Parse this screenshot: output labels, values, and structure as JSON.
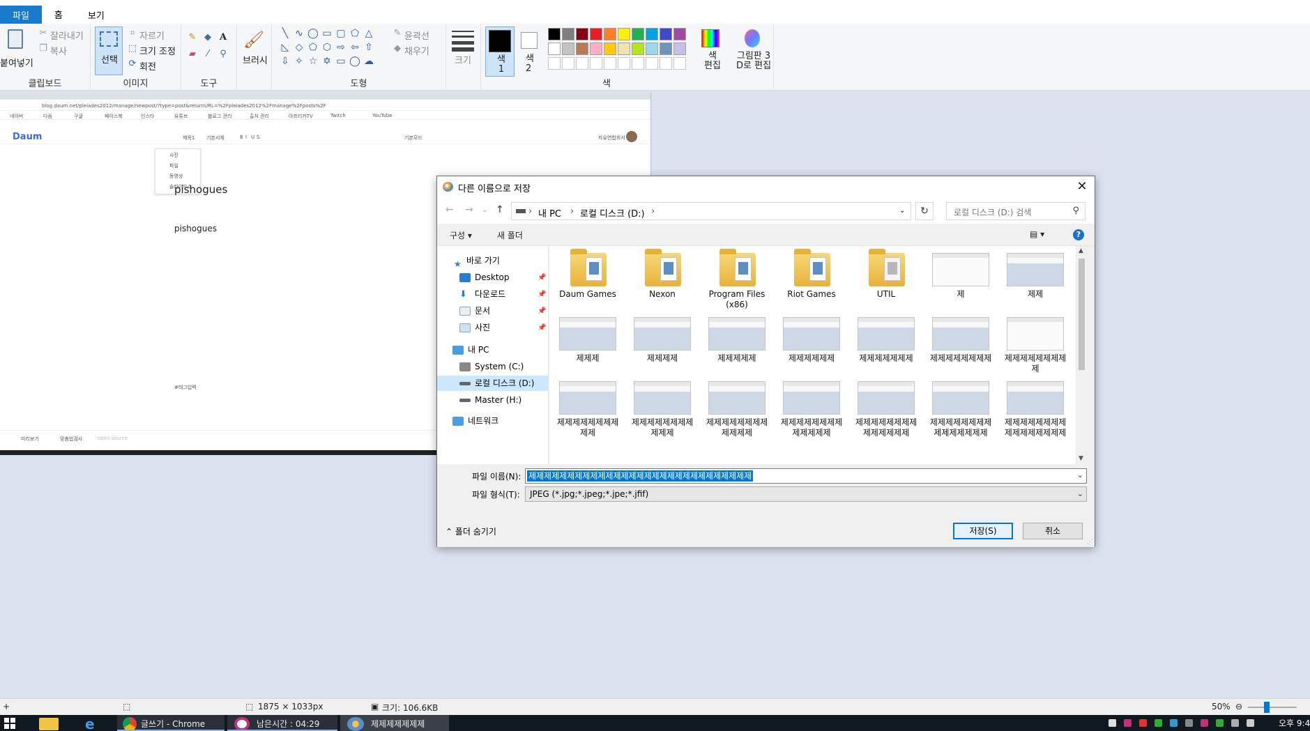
{
  "menu": {
    "file": "파일",
    "home": "홈",
    "view": "보기"
  },
  "ribbon": {
    "clipboard": {
      "paste": "붙여넣기",
      "cut": "잘라내기",
      "copy": "복사",
      "label": "클립보드"
    },
    "image": {
      "select": "선택",
      "crop": "자르기",
      "resize": "크기 조정",
      "rotate": "회전",
      "label": "이미지"
    },
    "tools": {
      "label": "도구"
    },
    "brushes": {
      "label": "브러시"
    },
    "shapes": {
      "outline": "윤곽선",
      "fill": "채우기",
      "label": "도형"
    },
    "size": {
      "label": "크기"
    },
    "colors": {
      "color1": "색\n1",
      "color2": "색\n2",
      "edit": "색\n편집",
      "label": "색",
      "palette_row1": [
        "#000000",
        "#7f7f7f",
        "#880015",
        "#ed1c24",
        "#ff7f27",
        "#fff200",
        "#22b14c",
        "#00a2e8",
        "#3f48cc",
        "#a349a4"
      ],
      "palette_row2": [
        "#ffffff",
        "#c3c3c3",
        "#b97a57",
        "#ffaec9",
        "#ffc90e",
        "#efe4b0",
        "#b5e61d",
        "#99d9ea",
        "#7092be",
        "#c8bfe7"
      ]
    },
    "paint3d": "그림판 3\nD로 편집"
  },
  "canvas": {
    "address": "blog.daum.net/pleiades2012/manage/newpost/?type=post&returnURL=%2Fpleiades2012%2Fmanage%2Fposts%2F",
    "bookmarks": [
      "네이버",
      "다음",
      "구글",
      "페이스북",
      "인스타",
      "유튜브",
      "블로그 관리",
      "출처 관리",
      "아프리카TV",
      "Twitch",
      "YouTube"
    ],
    "logo": "Daum",
    "toolbar_items": [
      "제목1",
      "기본서체",
      "B",
      "I",
      "U",
      "S",
      "기본모드"
    ],
    "dropdown": [
      "사진",
      "파일",
      "동영상",
      "슬라이드쇼"
    ],
    "title_text": "pishogues",
    "body_text": "pishogues",
    "tag_placeholder": "#태그입력",
    "footer_items": [
      "미리보기",
      "맞춤법검사",
      "open source"
    ],
    "user_name": "자유연합회서"
  },
  "dialog": {
    "title": "다른 이름으로 저장",
    "breadcrumb": [
      "내 PC",
      "로컬 디스크 (D:)"
    ],
    "search_placeholder": "로컬 디스크 (D:) 검색",
    "organize": "구성",
    "new_folder": "새 폴더",
    "tree": {
      "quick_access": "바로 가기",
      "desktop": "Desktop",
      "downloads": "다운로드",
      "documents": "문서",
      "pictures": "사진",
      "this_pc": "내 PC",
      "system_c": "System (C:)",
      "local_d": "로컬 디스크 (D:)",
      "master_h": "Master (H:)",
      "network": "네트워크"
    },
    "files": [
      {
        "name": "Daum Games",
        "kind": "folder"
      },
      {
        "name": "Nexon",
        "kind": "folder"
      },
      {
        "name": "Program Files (x86)",
        "kind": "folder"
      },
      {
        "name": "Riot Games",
        "kind": "folder"
      },
      {
        "name": "UTIL",
        "kind": "folder-gray"
      },
      {
        "name": "제",
        "kind": "image-white"
      },
      {
        "name": "제제",
        "kind": "image"
      },
      {
        "name": "제제제",
        "kind": "image"
      },
      {
        "name": "제제제제",
        "kind": "image"
      },
      {
        "name": "제제제제제",
        "kind": "image"
      },
      {
        "name": "제제제제제제",
        "kind": "image"
      },
      {
        "name": "제제제제제제제",
        "kind": "image"
      },
      {
        "name": "제제제제제제제제",
        "kind": "image"
      },
      {
        "name": "제제제제제제제제제",
        "kind": "image-white"
      },
      {
        "name": "제제제제제제제제제제",
        "kind": "image"
      },
      {
        "name": "제제제제제제제제제제제",
        "kind": "image"
      },
      {
        "name": "제제제제제제제제제제제제",
        "kind": "image"
      },
      {
        "name": "제제제제제제제제제제제제제",
        "kind": "image"
      },
      {
        "name": "제제제제제제제제제제제제제제",
        "kind": "image"
      },
      {
        "name": "제제제제제제제제제제제제제제제",
        "kind": "image"
      },
      {
        "name": "제제제제제제제제제제제제제제제제",
        "kind": "image"
      }
    ],
    "filename_label": "파일 이름(N):",
    "filename_value": "제제제제제제제제제제제제제제제제제제제제제제제제제제제제제",
    "filetype_label": "파일 형식(T):",
    "filetype_value": "JPEG (*.jpg;*.jpeg;*.jpe;*.jfif)",
    "hide_folders": "폴더 숨기기",
    "save": "저장(S)",
    "cancel": "취소"
  },
  "status": {
    "dimensions": "1875 × 1033px",
    "filesize": "크기: 106.6KB",
    "zoom": "50%"
  },
  "taskbar": {
    "chrome": "글쓰기 - Chrome",
    "timer": "남은시간 : 04:29",
    "paint": "제제제제제제제",
    "clock": "오후 9:4"
  }
}
